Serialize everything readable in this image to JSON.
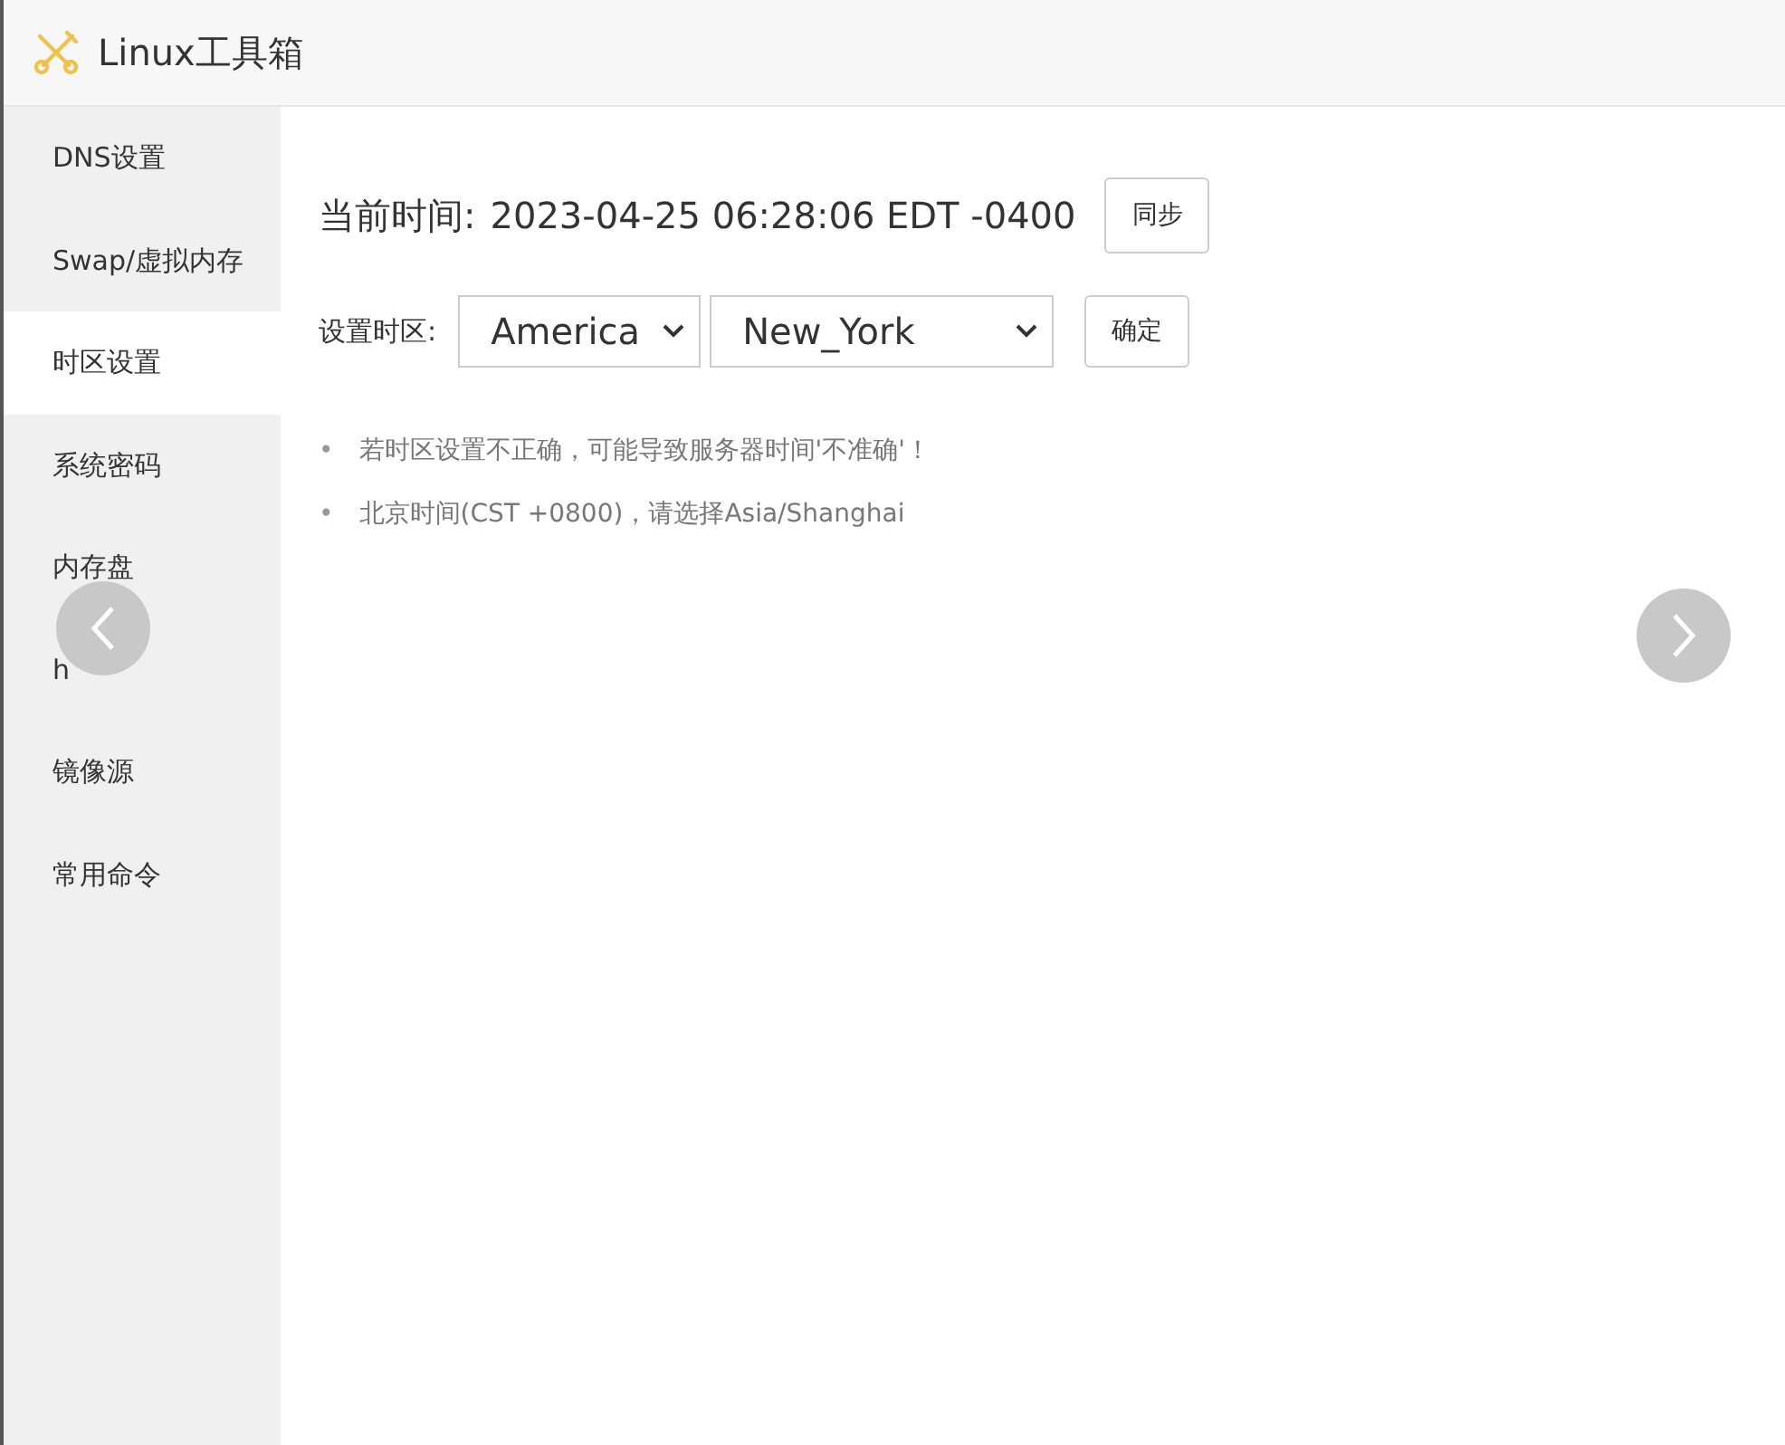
{
  "app": {
    "title": "Linux工具箱"
  },
  "sidebar": {
    "items": [
      {
        "label": "DNS设置",
        "selected": false
      },
      {
        "label": "Swap/虚拟内存",
        "selected": false
      },
      {
        "label": "时区设置",
        "selected": true
      },
      {
        "label": "系统密码",
        "selected": false
      },
      {
        "label": "内存盘",
        "selected": false
      },
      {
        "label": "h",
        "selected": false
      },
      {
        "label": "镜像源",
        "selected": false
      },
      {
        "label": "常用命令",
        "selected": false
      }
    ]
  },
  "time_row": {
    "label": "当前时间:",
    "value": "2023-04-25 06:28:06 EDT -0400",
    "button": "同步"
  },
  "zone_row": {
    "label": "设置时区:",
    "region": "America",
    "city": "New_York",
    "button": "确定"
  },
  "notes": [
    {
      "bullet": "•",
      "text": "若时区设置不正确，可能导致服务器时间'不准确'！"
    },
    {
      "bullet": "•",
      "text": "北京时间(CST +0800)，请选择Asia/Shanghai"
    }
  ]
}
